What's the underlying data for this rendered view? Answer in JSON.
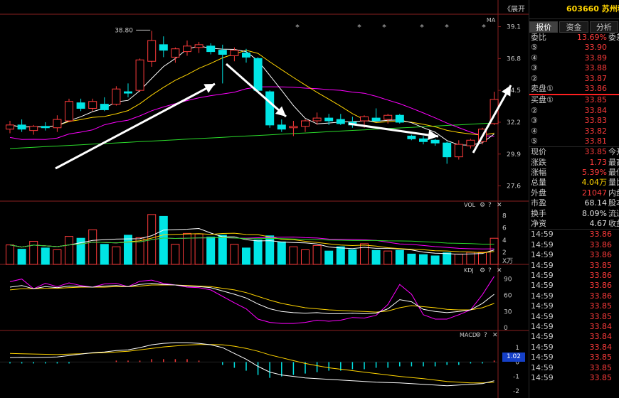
{
  "header": {
    "stock_code": "603660",
    "stock_name": "苏州科",
    "expand_label": "《展开"
  },
  "tabs": [
    {
      "label": "报价",
      "active": true
    },
    {
      "label": "资金",
      "active": false
    },
    {
      "label": "分析",
      "active": false
    }
  ],
  "quote": {
    "webi_label": "委比",
    "webi_value": "13.69%",
    "webi_extra": "委差",
    "sell": [
      {
        "idx": "⑤",
        "price": "33.90"
      },
      {
        "idx": "④",
        "price": "33.89"
      },
      {
        "idx": "③",
        "price": "33.88"
      },
      {
        "idx": "②",
        "price": "33.87"
      },
      {
        "idx": "卖盘①",
        "price": "33.86"
      }
    ],
    "buy": [
      {
        "idx": "买盘①",
        "price": "33.85"
      },
      {
        "idx": "②",
        "price": "33.84"
      },
      {
        "idx": "③",
        "price": "33.83"
      },
      {
        "idx": "④",
        "price": "33.82"
      },
      {
        "idx": "⑤",
        "price": "33.81"
      }
    ],
    "stats": [
      {
        "label": "现价",
        "value": "33.85",
        "extra": "今开",
        "cls": "red"
      },
      {
        "label": "涨跌",
        "value": "1.73",
        "extra": "最高",
        "cls": "red"
      },
      {
        "label": "涨幅",
        "value": "5.39%",
        "extra": "最低",
        "cls": "red"
      },
      {
        "label": "总量",
        "value": "4.04万",
        "extra": "量比",
        "cls": "yellow"
      },
      {
        "label": "外盘",
        "value": "21047",
        "extra": "内盘",
        "cls": "red"
      },
      {
        "label": "市盈",
        "value": "68.14",
        "extra": "股本",
        "cls": "white"
      },
      {
        "label": "换手",
        "value": "8.09%",
        "extra": "流通",
        "cls": "white"
      },
      {
        "label": "净资",
        "value": "4.67",
        "extra": "收益",
        "cls": "white"
      }
    ],
    "ticks": [
      {
        "time": "14:59",
        "price": "33.86"
      },
      {
        "time": "14:59",
        "price": "33.86"
      },
      {
        "time": "14:59",
        "price": "33.86"
      },
      {
        "time": "14:59",
        "price": "33.85"
      },
      {
        "time": "14:59",
        "price": "33.86"
      },
      {
        "time": "14:59",
        "price": "33.86"
      },
      {
        "time": "14:59",
        "price": "33.86"
      },
      {
        "time": "14:59",
        "price": "33.85"
      },
      {
        "time": "14:59",
        "price": "33.85"
      },
      {
        "time": "14:59",
        "price": "33.84"
      },
      {
        "time": "14:59",
        "price": "33.84"
      },
      {
        "time": "14:59",
        "price": "33.84"
      },
      {
        "time": "14:59",
        "price": "33.85"
      },
      {
        "time": "14:59",
        "price": "33.85"
      },
      {
        "time": "14:59",
        "price": "33.85"
      }
    ]
  },
  "price_panel": {
    "ma_label": "MA",
    "high_marker": "38.80",
    "y_labels": [
      "39.1",
      "36.8",
      "34.5",
      "32.2",
      "29.9",
      "27.6"
    ]
  },
  "vol_panel": {
    "title": "VOL",
    "y_labels": [
      "8",
      "6",
      "4",
      "2"
    ],
    "unit": "X万"
  },
  "kdj_panel": {
    "title": "KDJ",
    "y_labels": [
      "90",
      "60",
      "30",
      "0"
    ]
  },
  "macd_panel": {
    "title": "MACD",
    "y_labels": [
      "1",
      "0",
      "-1",
      "-2"
    ],
    "badge": "1.02"
  },
  "colors": {
    "up": "#ff3b3b",
    "down": "#00e5e5",
    "ma5": "#ffffff",
    "ma10": "#ffd400",
    "ma20": "#ff00ff",
    "ma60": "#2bdc2b"
  },
  "chart_data": {
    "type": "candlestick",
    "y_range": [
      26.5,
      40.0
    ],
    "candles": [
      {
        "o": 31.7,
        "h": 32.3,
        "l": 31.4,
        "c": 32.0
      },
      {
        "o": 32.0,
        "h": 32.4,
        "l": 31.5,
        "c": 31.7
      },
      {
        "o": 31.6,
        "h": 32.0,
        "l": 31.3,
        "c": 31.9
      },
      {
        "o": 31.9,
        "h": 32.2,
        "l": 31.6,
        "c": 31.8
      },
      {
        "o": 31.8,
        "h": 32.7,
        "l": 31.5,
        "c": 32.4
      },
      {
        "o": 32.3,
        "h": 33.9,
        "l": 32.2,
        "c": 33.7
      },
      {
        "o": 33.6,
        "h": 33.9,
        "l": 33.0,
        "c": 33.2
      },
      {
        "o": 33.2,
        "h": 33.9,
        "l": 33.0,
        "c": 33.7
      },
      {
        "o": 33.5,
        "h": 34.0,
        "l": 33.0,
        "c": 33.1
      },
      {
        "o": 33.5,
        "h": 34.8,
        "l": 33.4,
        "c": 34.6
      },
      {
        "o": 34.4,
        "h": 35.0,
        "l": 34.0,
        "c": 34.3
      },
      {
        "o": 34.5,
        "h": 36.8,
        "l": 34.4,
        "c": 36.7
      },
      {
        "o": 36.6,
        "h": 38.8,
        "l": 36.2,
        "c": 38.1
      },
      {
        "o": 37.8,
        "h": 38.4,
        "l": 36.9,
        "c": 37.4
      },
      {
        "o": 36.9,
        "h": 37.6,
        "l": 36.5,
        "c": 37.5
      },
      {
        "o": 37.3,
        "h": 38.1,
        "l": 37.0,
        "c": 37.7
      },
      {
        "o": 37.6,
        "h": 38.0,
        "l": 37.2,
        "c": 37.8
      },
      {
        "o": 37.7,
        "h": 37.9,
        "l": 37.1,
        "c": 37.3
      },
      {
        "o": 37.4,
        "h": 37.8,
        "l": 35.0,
        "c": 37.1
      },
      {
        "o": 37.0,
        "h": 37.6,
        "l": 36.6,
        "c": 37.4
      },
      {
        "o": 37.2,
        "h": 37.5,
        "l": 36.5,
        "c": 36.9
      },
      {
        "o": 36.8,
        "h": 36.9,
        "l": 34.4,
        "c": 34.5
      },
      {
        "o": 34.4,
        "h": 34.5,
        "l": 31.8,
        "c": 32.0
      },
      {
        "o": 32.0,
        "h": 32.4,
        "l": 31.5,
        "c": 31.7
      },
      {
        "o": 31.8,
        "h": 32.3,
        "l": 31.2,
        "c": 31.9
      },
      {
        "o": 31.9,
        "h": 32.4,
        "l": 31.5,
        "c": 32.3
      },
      {
        "o": 32.3,
        "h": 32.9,
        "l": 32.0,
        "c": 32.5
      },
      {
        "o": 32.5,
        "h": 32.8,
        "l": 32.0,
        "c": 32.3
      },
      {
        "o": 32.4,
        "h": 32.8,
        "l": 32.0,
        "c": 32.1
      },
      {
        "o": 32.2,
        "h": 32.6,
        "l": 31.8,
        "c": 32.0
      },
      {
        "o": 32.3,
        "h": 32.7,
        "l": 31.8,
        "c": 32.6
      },
      {
        "o": 32.5,
        "h": 33.2,
        "l": 32.3,
        "c": 32.3
      },
      {
        "o": 32.4,
        "h": 32.8,
        "l": 32.1,
        "c": 32.7
      },
      {
        "o": 32.7,
        "h": 32.8,
        "l": 32.1,
        "c": 32.2
      },
      {
        "o": 31.2,
        "h": 31.3,
        "l": 30.9,
        "c": 31.0
      },
      {
        "o": 31.0,
        "h": 31.2,
        "l": 30.6,
        "c": 30.8
      },
      {
        "o": 30.9,
        "h": 31.0,
        "l": 30.5,
        "c": 30.7
      },
      {
        "o": 30.7,
        "h": 30.8,
        "l": 29.2,
        "c": 29.7
      },
      {
        "o": 29.7,
        "h": 30.9,
        "l": 29.5,
        "c": 30.6
      },
      {
        "o": 30.5,
        "h": 31.0,
        "l": 30.3,
        "c": 30.9
      },
      {
        "o": 30.8,
        "h": 31.8,
        "l": 30.6,
        "c": 31.7
      },
      {
        "o": 32.1,
        "h": 34.4,
        "l": 32.0,
        "c": 33.85
      }
    ],
    "volumes": [
      3.2,
      2.5,
      3.8,
      2.7,
      2.4,
      4.6,
      4.3,
      5.7,
      3.3,
      2.9,
      4.8,
      4.4,
      8.2,
      7.9,
      3.3,
      5.1,
      5.0,
      4.5,
      4.8,
      3.3,
      2.7,
      4.0,
      4.7,
      3.7,
      2.9,
      2.4,
      3.1,
      2.2,
      2.9,
      2.4,
      3.4,
      2.3,
      2.2,
      2.3,
      1.7,
      1.6,
      1.4,
      1.9,
      1.7,
      2.0,
      2.0,
      4.3
    ],
    "kdj": {
      "k": [
        75,
        78,
        72,
        76,
        74,
        77,
        76,
        75,
        77,
        78,
        76,
        80,
        82,
        80,
        79,
        77,
        76,
        74,
        68,
        62,
        55,
        44,
        35,
        30,
        28,
        27,
        28,
        26,
        26,
        27,
        26,
        27,
        35,
        52,
        48,
        34,
        30,
        28,
        30,
        33,
        45,
        62
      ],
      "d": [
        70,
        72,
        72,
        73,
        73,
        74,
        75,
        75,
        75,
        76,
        76,
        77,
        79,
        79,
        79,
        78,
        77,
        76,
        73,
        70,
        65,
        58,
        51,
        45,
        41,
        37,
        35,
        33,
        32,
        31,
        30,
        29,
        31,
        37,
        41,
        39,
        37,
        34,
        33,
        33,
        37,
        45
      ],
      "j": [
        85,
        90,
        72,
        82,
        76,
        83,
        78,
        75,
        81,
        82,
        76,
        86,
        88,
        82,
        79,
        75,
        74,
        70,
        58,
        46,
        35,
        16,
        10,
        8,
        8,
        10,
        14,
        12,
        14,
        19,
        18,
        23,
        43,
        80,
        62,
        24,
        16,
        16,
        24,
        33,
        61,
        95
      ]
    },
    "macd": {
      "dif": [
        0.3,
        0.32,
        0.31,
        0.33,
        0.35,
        0.45,
        0.55,
        0.65,
        0.7,
        0.8,
        0.85,
        1.0,
        1.2,
        1.3,
        1.35,
        1.35,
        1.3,
        1.2,
        1.0,
        0.6,
        0.2,
        -0.3,
        -0.7,
        -0.9,
        -1.0,
        -1.1,
        -1.15,
        -1.2,
        -1.25,
        -1.3,
        -1.35,
        -1.4,
        -1.42,
        -1.45,
        -1.5,
        -1.55,
        -1.6,
        -1.65,
        -1.6,
        -1.55,
        -1.5,
        -1.3
      ],
      "dea": [
        0.6,
        0.58,
        0.56,
        0.54,
        0.52,
        0.55,
        0.58,
        0.62,
        0.65,
        0.7,
        0.75,
        0.85,
        0.95,
        1.05,
        1.12,
        1.18,
        1.22,
        1.22,
        1.2,
        1.1,
        0.95,
        0.75,
        0.5,
        0.3,
        0.1,
        -0.1,
        -0.25,
        -0.4,
        -0.5,
        -0.6,
        -0.7,
        -0.8,
        -0.9,
        -1.0,
        -1.08,
        -1.15,
        -1.25,
        -1.35,
        -1.4,
        -1.45,
        -1.45,
        -1.4
      ],
      "hist": [
        -0.1,
        -0.1,
        -0.1,
        -0.1,
        -0.1,
        -0.1,
        0,
        0,
        0,
        0.1,
        0.1,
        0.1,
        0.2,
        0.2,
        0.2,
        0.2,
        0.1,
        0,
        -0.2,
        -0.4,
        -0.6,
        -0.9,
        -1.1,
        -1.0,
        -0.9,
        -0.8,
        -0.7,
        -0.6,
        -0.6,
        -0.5,
        -0.5,
        -0.4,
        -0.4,
        -0.3,
        -0.3,
        -0.3,
        -0.3,
        -0.2,
        -0.2,
        -0.1,
        -0.1,
        0.1
      ]
    }
  }
}
